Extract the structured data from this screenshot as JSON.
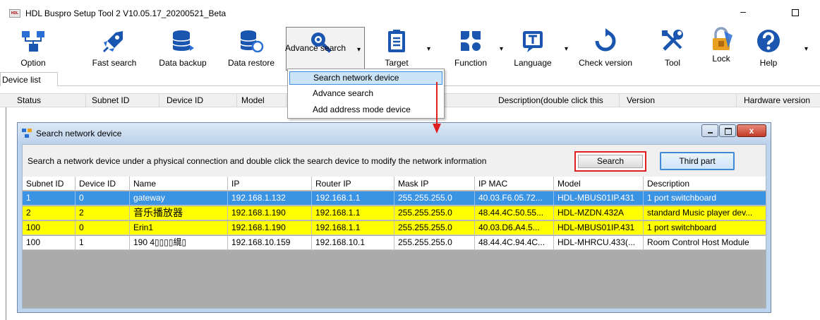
{
  "window": {
    "app_logo_text": "HDL",
    "title": "HDL Buspro Setup Tool 2 V10.05.17_20200521_Beta",
    "minimize_glyph": "–"
  },
  "toolbar": {
    "option": "Option",
    "fast_search": "Fast search",
    "data_backup": "Data backup",
    "data_restore": "Data restore",
    "advance_search": "Advance search",
    "target": "Target",
    "function": "Function",
    "language": "Language",
    "check_version": "Check version",
    "tool": "Tool",
    "lock": "Lock",
    "help": "Help",
    "dropdown_arrow": "▾"
  },
  "tabs": {
    "device_list": "Device list"
  },
  "main_table": {
    "columns": [
      "Status",
      "Subnet ID",
      "Device ID",
      "Model",
      "Description(double click this",
      "Version",
      "Hardware version"
    ]
  },
  "advance_menu": {
    "items": [
      "Search network device",
      "Advance search",
      "Add address mode device"
    ]
  },
  "dialog": {
    "title": "Search network device",
    "close_glyph": "x",
    "instruction": "Search a network device under a physical connection and double click the search device to modify the network information",
    "search_button": "Search",
    "third_part_button": "Third part",
    "columns": [
      "Subnet ID",
      "Device ID",
      "Name",
      "IP",
      "Router IP",
      "Mask IP",
      "IP MAC",
      "Model",
      "Description"
    ],
    "rows": [
      {
        "subnet": "1",
        "device": "0",
        "name": "gateway",
        "ip": "192.168.1.132",
        "router": "192.168.1.1",
        "mask": "255.255.255.0",
        "mac": "40.03.F6.05.72...",
        "model": "HDL-MBUS01IP.431",
        "desc": "1 port switchboard"
      },
      {
        "subnet": "2",
        "device": "2",
        "name": "音乐播放器",
        "ip": "192.168.1.190",
        "router": "192.168.1.1",
        "mask": "255.255.255.0",
        "mac": "48.44.4C.50.55...",
        "model": "HDL-MZDN.432A",
        "desc": "standard Music player dev..."
      },
      {
        "subnet": "100",
        "device": "0",
        "name": "Erin1",
        "ip": "192.168.1.190",
        "router": "192.168.1.1",
        "mask": "255.255.255.0",
        "mac": "40.03.D6.A4.5...",
        "model": "HDL-MBUS01IP.431",
        "desc": "1 port switchboard"
      },
      {
        "subnet": "100",
        "device": "1",
        "name": "190  4▯▯▯▯繉▯",
        "ip": "192.168.10.159",
        "router": "192.168.10.1",
        "mask": "255.255.255.0",
        "mac": "48.44.4C.94.4C...",
        "model": "HDL-MHRCU.433(...",
        "desc": "Room Control Host Module"
      }
    ]
  },
  "colors": {
    "selected_row": "#3b93e4",
    "highlight_row": "#ffff00",
    "annotation_red": "#e02020",
    "menu_selection": "#cce4f7",
    "dialog_frame": "#bcd4ee"
  }
}
